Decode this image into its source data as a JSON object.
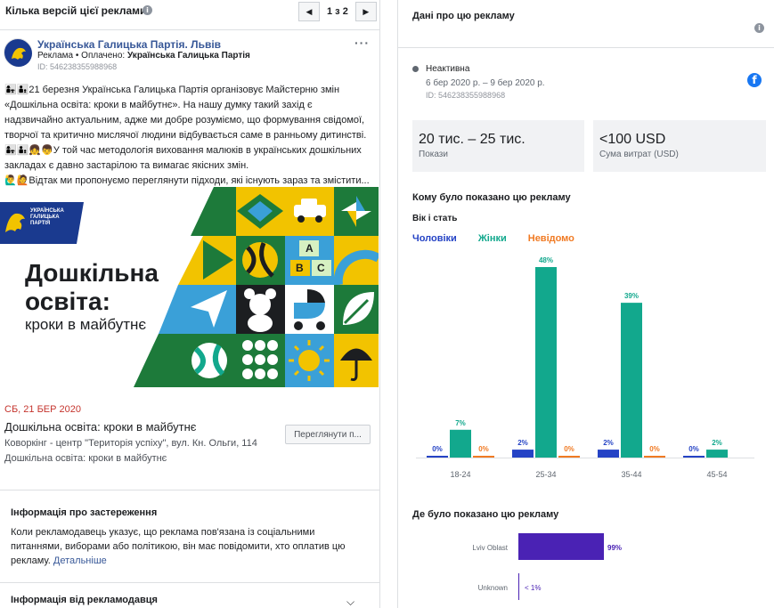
{
  "left": {
    "header": {
      "title": "Кілька версій цієї реклами",
      "pager": "1 з 2"
    },
    "post": {
      "page_name": "Українська Галицька Партія. Львів",
      "sponsored_prefix": "Реклама • Оплачено:",
      "paid_by": "Українська Галицька Партія",
      "ad_id": "ID: 546238355988968",
      "text_lines": [
        "👩‍👧👨‍👦21 березня Українська Галицька Партія організовує Майстерню змін",
        "«Дошкільна освіта: кроки в майбутнє». На нашу думку такий захід є",
        "надзвичайно актуальним, адже ми добре розуміємо, що формування свідомої,",
        "творчої та критично мислячої людини відбувається саме в ранньому дитинстві.",
        "👩‍👧👨‍👦👧👦У той час методологія виховання малюків в українських дошкільних",
        "закладах є давно застарілою та вимагає якісних змін.",
        "🙋‍♂️🙋Відтак ми пропонуємо переглянути підходи, які існують зараз та змістити..."
      ],
      "creative": {
        "logo_text_1": "УКРАЇНСЬКА",
        "logo_text_2": "ГАЛИЦЬКА",
        "logo_text_3": "ПАРТІЯ",
        "title_1": "Дошкільна",
        "title_2": "освіта:",
        "subtitle": "кроки в майбутнє",
        "abc": [
          "A",
          "B",
          "C"
        ]
      },
      "event_date": "СБ, 21 БЕР 2020",
      "event_title": "Дошкільна освіта: кроки в майбутнє",
      "event_location": "Коворкінг - центр \"Територія успіху\", вул. Кн. Ольги, 114",
      "event_desc": "Дошкільна освіта: кроки в майбутнє",
      "view_button": "Переглянути п..."
    },
    "disclaimer": {
      "heading": "Інформація про застереження",
      "text": "Коли рекламодавець указує, що реклама пов'язана із соціальними питаннями, виборами або політикою, він має повідомити, хто оплатив цю рекламу.",
      "link": "Детальніше"
    },
    "advertiser": {
      "heading": "Інформація від рекламодавця"
    }
  },
  "right": {
    "header": {
      "title": "Дані про цю рекламу"
    },
    "status": "Неактивна",
    "dates": "6 бер 2020 р. – 9 бер 2020 р.",
    "ad_id": "ID: 546238355988968",
    "metrics": [
      {
        "value": "20 тис. – 25 тис.",
        "label": "Покази"
      },
      {
        "value": "<100 USD",
        "label": "Сума витрат (USD)"
      }
    ],
    "shown_heading": "Кому було показано цю рекламу",
    "age_sex_heading": "Вік і стать",
    "legend": [
      {
        "name": "Чоловіки",
        "color": "#2543c5"
      },
      {
        "name": "Жінки",
        "color": "#12a88d"
      },
      {
        "name": "Невідомо",
        "color": "#f07a23"
      }
    ],
    "where_heading": "Де було показано цю рекламу"
  },
  "chart_data": [
    {
      "type": "bar",
      "categories": [
        "18-24",
        "25-34",
        "35-44",
        "45-54"
      ],
      "series": [
        {
          "name": "Чоловіки",
          "values": [
            0,
            2,
            2,
            0
          ],
          "labels": [
            "0%",
            "2%",
            "2%",
            "0%"
          ],
          "color": "#2543c5"
        },
        {
          "name": "Жінки",
          "values": [
            7,
            48,
            39,
            2
          ],
          "labels": [
            "7%",
            "48%",
            "39%",
            "2%"
          ],
          "color": "#12a88d"
        },
        {
          "name": "Невідомо",
          "values": [
            0,
            0,
            0,
            null
          ],
          "labels": [
            "0%",
            "0%",
            "0%",
            ""
          ],
          "color": "#f07a23"
        }
      ],
      "ylim": [
        0,
        48
      ]
    },
    {
      "type": "bar",
      "orientation": "horizontal",
      "categories": [
        "Lviv Oblast",
        "Unknown"
      ],
      "values": [
        99,
        1
      ],
      "labels": [
        "99%",
        "< 1%"
      ],
      "color": "#4a22b4"
    }
  ]
}
